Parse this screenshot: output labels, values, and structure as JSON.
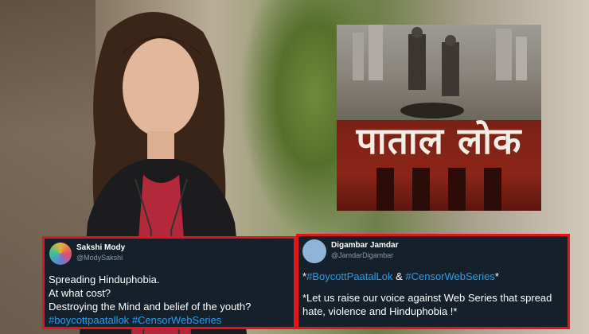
{
  "poster": {
    "title": "पाताल लोक"
  },
  "tweets": [
    {
      "name": "Sakshi Mody",
      "handle": "@ModySakshi",
      "lines": [
        "Spreading Hinduphobia.",
        "At what cost?",
        "Destroying the Mind and belief of the youth?"
      ],
      "hashtags": [
        "#boycottpaatallok",
        "#CensorWebSeries"
      ]
    },
    {
      "name": "Digambar Jamdar",
      "handle": "@JamdarDigambar",
      "hashtag_line": {
        "prefix": "*",
        "tag1": "#BoycottPaatalLok",
        "joiner": " & ",
        "tag2": "#CensorWebSeries",
        "suffix": "*"
      },
      "lines": [
        "*Let us raise our voice against Web Series that spread",
        "hate, violence and Hinduphobia !*"
      ]
    }
  ],
  "colors": {
    "tweet_background": "#15202b",
    "highlight_border": "#e5141a",
    "hashtag": "#1da1f2",
    "handle": "#8899a6"
  }
}
